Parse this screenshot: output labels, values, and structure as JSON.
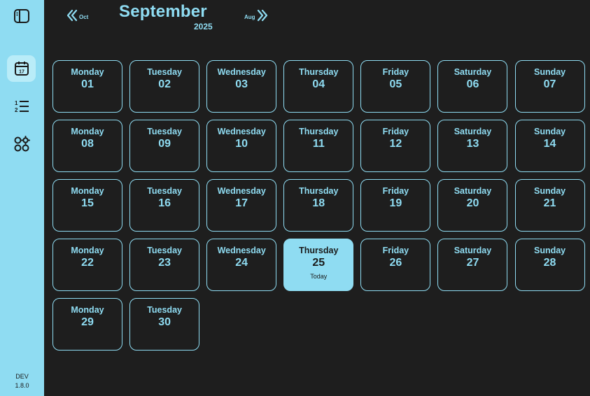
{
  "app": {
    "version_env": "DEV",
    "version_number": "1.8.0"
  },
  "sidebar": {
    "items": [
      {
        "icon": "sidebar-toggle-icon",
        "active": false
      },
      {
        "icon": "calendar-icon",
        "active": true
      },
      {
        "icon": "list-icon",
        "active": false
      },
      {
        "icon": "apps-settings-icon",
        "active": false
      }
    ]
  },
  "header": {
    "month": "September",
    "year": "2025",
    "prev_label": "Oct",
    "next_label": "Aug"
  },
  "days": [
    {
      "name": "Monday",
      "num": "01"
    },
    {
      "name": "Tuesday",
      "num": "02"
    },
    {
      "name": "Wednesday",
      "num": "03"
    },
    {
      "name": "Thursday",
      "num": "04"
    },
    {
      "name": "Friday",
      "num": "05"
    },
    {
      "name": "Saturday",
      "num": "06"
    },
    {
      "name": "Sunday",
      "num": "07"
    },
    {
      "name": "Monday",
      "num": "08"
    },
    {
      "name": "Tuesday",
      "num": "09"
    },
    {
      "name": "Wednesday",
      "num": "10"
    },
    {
      "name": "Thursday",
      "num": "11"
    },
    {
      "name": "Friday",
      "num": "12"
    },
    {
      "name": "Saturday",
      "num": "13"
    },
    {
      "name": "Sunday",
      "num": "14"
    },
    {
      "name": "Monday",
      "num": "15"
    },
    {
      "name": "Tuesday",
      "num": "16"
    },
    {
      "name": "Wednesday",
      "num": "17"
    },
    {
      "name": "Thursday",
      "num": "18"
    },
    {
      "name": "Friday",
      "num": "19"
    },
    {
      "name": "Saturday",
      "num": "20"
    },
    {
      "name": "Sunday",
      "num": "21"
    },
    {
      "name": "Monday",
      "num": "22"
    },
    {
      "name": "Tuesday",
      "num": "23"
    },
    {
      "name": "Wednesday",
      "num": "24"
    },
    {
      "name": "Thursday",
      "num": "25",
      "today": "Today"
    },
    {
      "name": "Friday",
      "num": "26"
    },
    {
      "name": "Saturday",
      "num": "27"
    },
    {
      "name": "Sunday",
      "num": "28"
    },
    {
      "name": "Monday",
      "num": "29"
    },
    {
      "name": "Tuesday",
      "num": "30"
    }
  ],
  "colors": {
    "accent": "#8fdcf2",
    "background": "#1e1e1e",
    "active_nav": "#b9ecf8"
  }
}
